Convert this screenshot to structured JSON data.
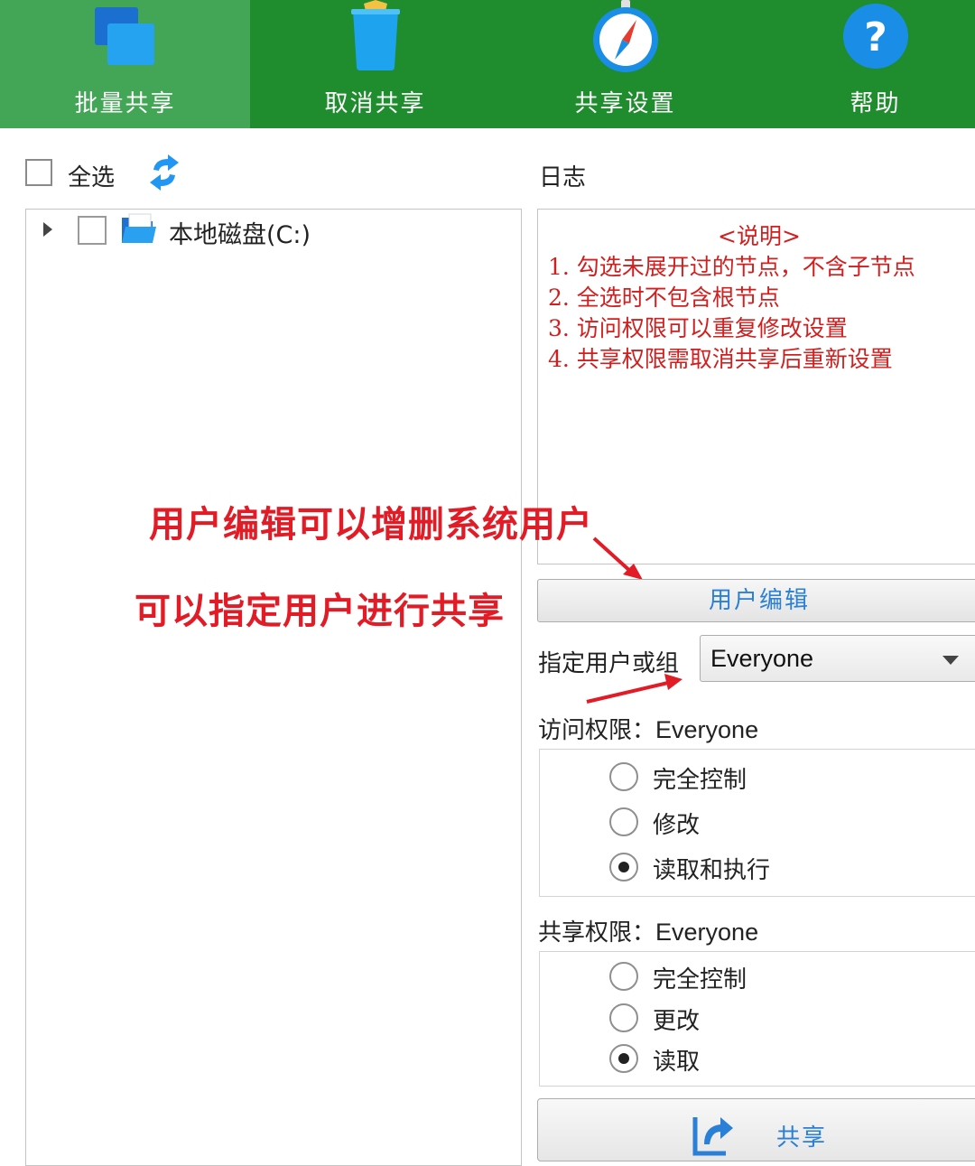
{
  "toolbar": {
    "items": [
      {
        "label": "批量共享",
        "icon": "stacked-windows-icon",
        "active": true
      },
      {
        "label": "取消共享",
        "icon": "trash-bin-icon",
        "active": false
      },
      {
        "label": "共享设置",
        "icon": "compass-icon",
        "active": false
      },
      {
        "label": "帮助",
        "icon": "help-icon",
        "active": false
      }
    ],
    "bg_color": "#1f8c2e",
    "active_color": "#43a556"
  },
  "select_all": {
    "label": "全选",
    "checked": false
  },
  "tree": {
    "nodes": [
      {
        "label": "本地磁盘(C:)",
        "expanded": false,
        "checked": false,
        "icon": "open-folder-icon"
      }
    ]
  },
  "log": {
    "title": "日志",
    "heading": "<说明>",
    "lines": [
      "1. 勾选未展开过的节点，不含子节点",
      "2. 全选时不包含根节点",
      "3. 访问权限可以重复修改设置",
      "4. 共享权限需取消共享后重新设置"
    ],
    "text_color": "#d11f1f"
  },
  "annotations": {
    "line1": "用户编辑可以增删系统用户",
    "line2": "可以指定用户进行共享",
    "color": "#e21c26"
  },
  "user_edit_button": {
    "label": "用户编辑"
  },
  "user_group": {
    "label": "指定用户或组",
    "value": "Everyone"
  },
  "access_permissions": {
    "title": "访问权限：",
    "user": "Everyone",
    "options": [
      {
        "label": "完全控制",
        "selected": false
      },
      {
        "label": "修改",
        "selected": false
      },
      {
        "label": "读取和执行",
        "selected": true
      }
    ]
  },
  "share_permissions": {
    "title": "共享权限：",
    "user": "Everyone",
    "options": [
      {
        "label": "完全控制",
        "selected": false
      },
      {
        "label": "更改",
        "selected": false
      },
      {
        "label": "读取",
        "selected": true
      }
    ]
  },
  "share_button": {
    "label": "共享",
    "icon": "share-arrow-icon"
  },
  "accent_color": "#2a7fd6"
}
